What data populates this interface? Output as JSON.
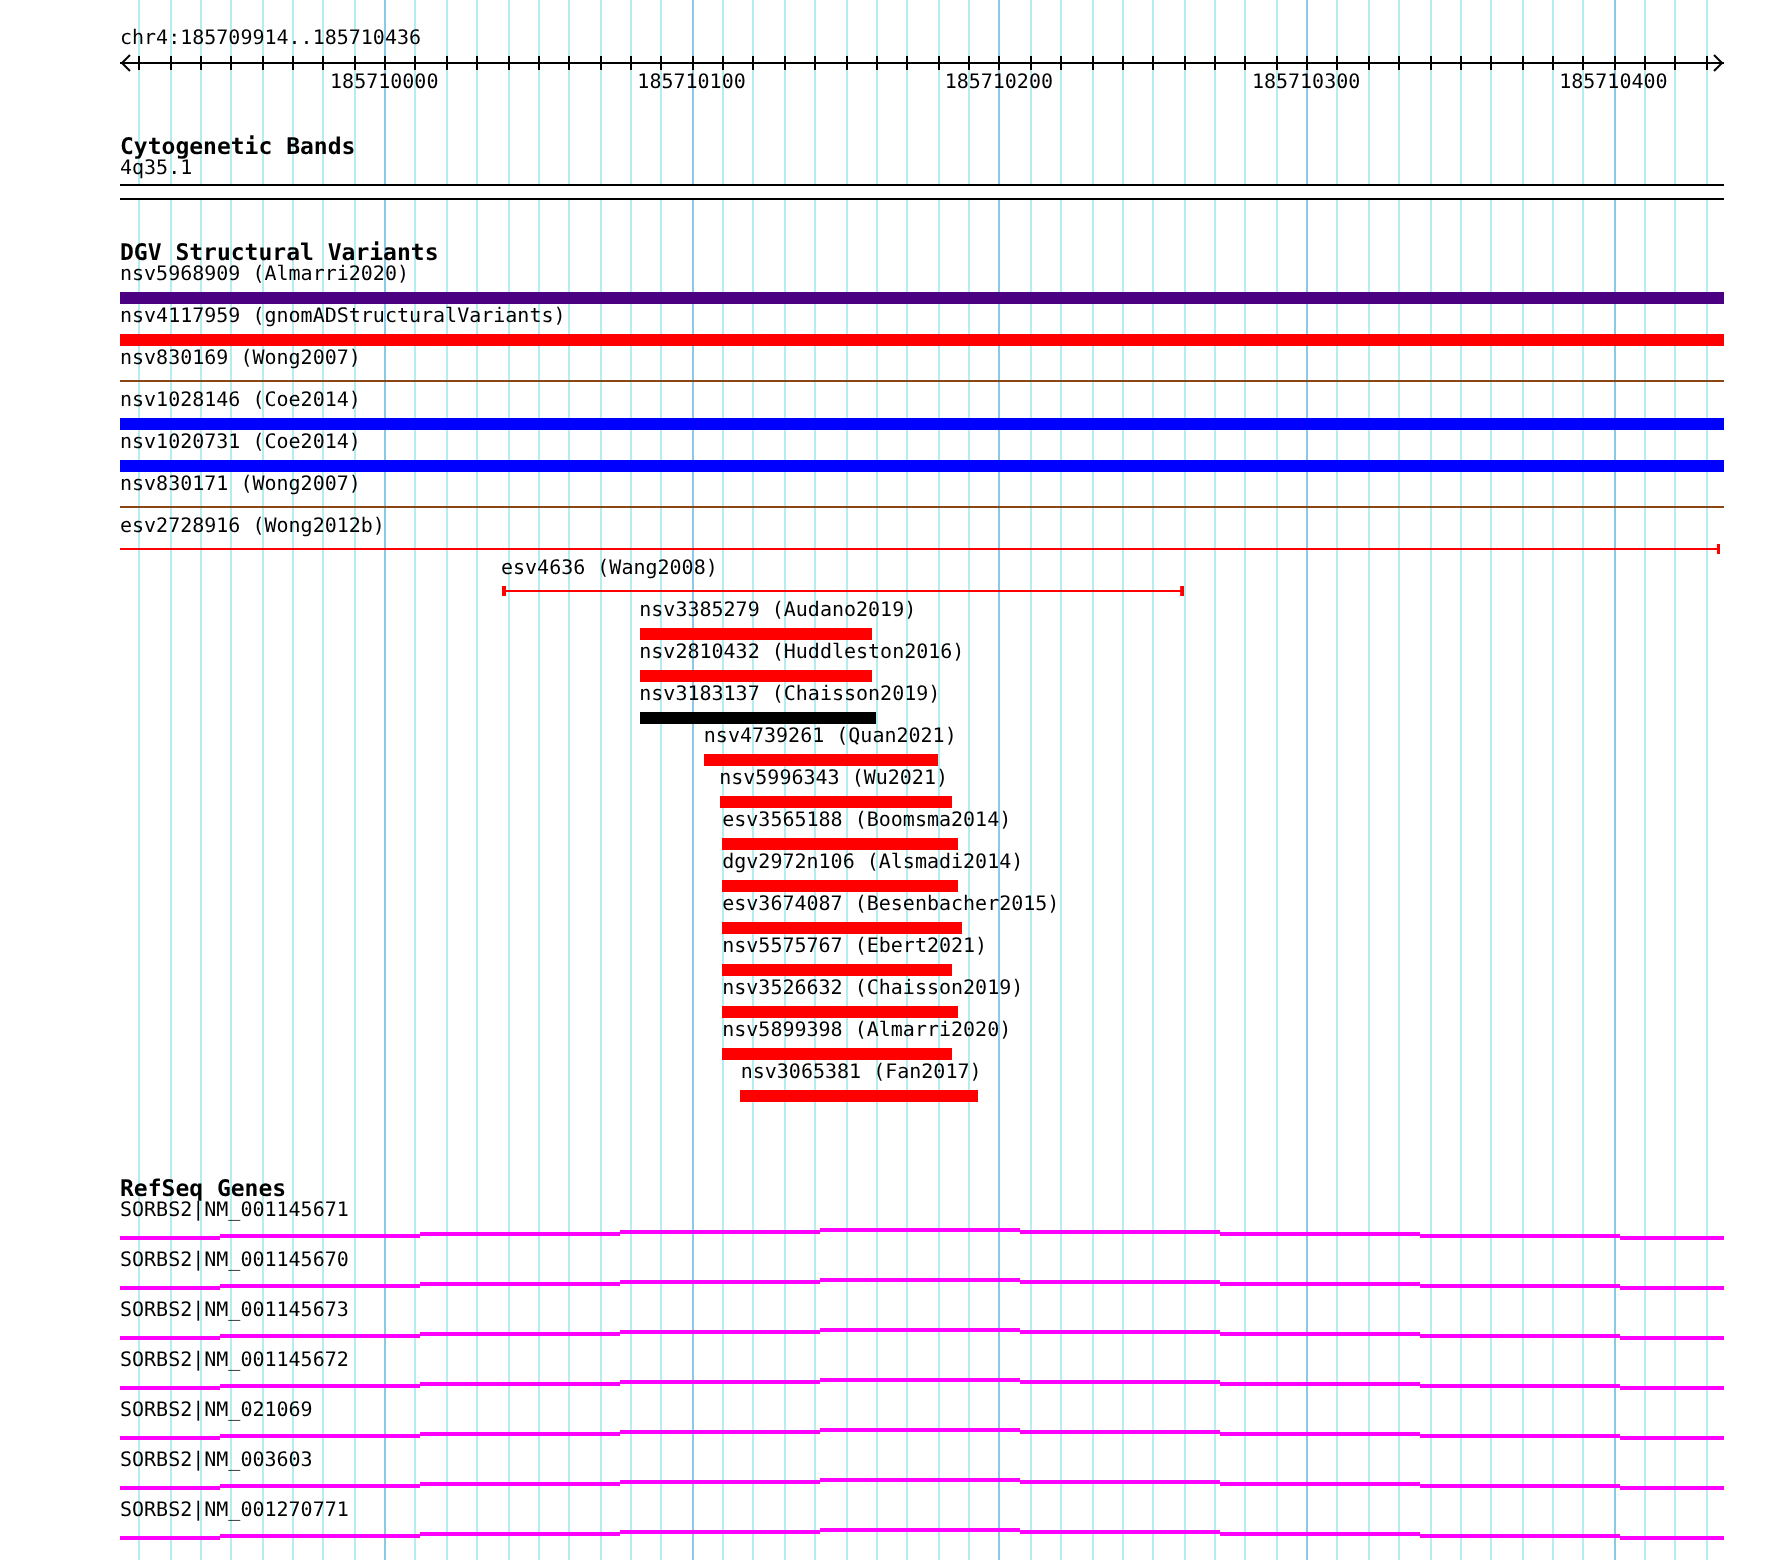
{
  "ruler": {
    "location": "chr4:185709914..185710436",
    "tick_labels": [
      "185710000",
      "185710100",
      "185710200",
      "185710300",
      "185710400"
    ]
  },
  "cytogenetic_bands": {
    "title": "Cytogenetic Bands",
    "band": "4q35.1"
  },
  "dgv_structural_variants": {
    "title": "DGV Structural Variants",
    "features": [
      {
        "label": "nsv5968909 (Almarri2020)",
        "kind": "thick",
        "color": "#4b0082"
      },
      {
        "label": "nsv4117959 (gnomADStructuralVariants)",
        "kind": "thick",
        "color": "#ff0000"
      },
      {
        "label": "nsv830169 (Wong2007)",
        "kind": "thin",
        "color": "#8b4513"
      },
      {
        "label": "nsv1028146 (Coe2014)",
        "kind": "thick",
        "color": "#0000ff"
      },
      {
        "label": "nsv1020731 (Coe2014)",
        "kind": "thick",
        "color": "#0000ff"
      },
      {
        "label": "nsv830171 (Wong2007)",
        "kind": "thin",
        "color": "#8b4513"
      },
      {
        "label": "esv2728916 (Wong2012b)",
        "kind": "thin",
        "color": "#ff0000"
      },
      {
        "label": "esv4636 (Wang2008)",
        "kind": "thin",
        "color": "#ff0000"
      },
      {
        "label": "nsv3385279 (Audano2019)",
        "kind": "thick",
        "color": "#ff0000"
      },
      {
        "label": "nsv2810432 (Huddleston2016)",
        "kind": "thick",
        "color": "#ff0000"
      },
      {
        "label": "nsv3183137 (Chaisson2019)",
        "kind": "thick",
        "color": "#000000"
      },
      {
        "label": "nsv4739261 (Quan2021)",
        "kind": "thick",
        "color": "#ff0000"
      },
      {
        "label": "nsv5996343 (Wu2021)",
        "kind": "thick",
        "color": "#ff0000"
      },
      {
        "label": "esv3565188 (Boomsma2014)",
        "kind": "thick",
        "color": "#ff0000"
      },
      {
        "label": "dgv2972n106 (Alsmadi2014)",
        "kind": "thick",
        "color": "#ff0000"
      },
      {
        "label": "esv3674087 (Besenbacher2015)",
        "kind": "thick",
        "color": "#ff0000"
      },
      {
        "label": "nsv5575767 (Ebert2021)",
        "kind": "thick",
        "color": "#ff0000"
      },
      {
        "label": "nsv3526632 (Chaisson2019)",
        "kind": "thick",
        "color": "#ff0000"
      },
      {
        "label": "nsv5899398 (Almarri2020)",
        "kind": "thick",
        "color": "#ff0000"
      },
      {
        "label": "nsv3065381 (Fan2017)",
        "kind": "thick",
        "color": "#ff0000"
      }
    ]
  },
  "refseq_genes": {
    "title": "RefSeq Genes",
    "genes": [
      {
        "label": "SORBS2|NM_001145671"
      },
      {
        "label": "SORBS2|NM_001145670"
      },
      {
        "label": "SORBS2|NM_001145673"
      },
      {
        "label": "SORBS2|NM_001145672"
      },
      {
        "label": "SORBS2|NM_021069"
      },
      {
        "label": "SORBS2|NM_003603"
      },
      {
        "label": "SORBS2|NM_001270771"
      }
    ]
  }
}
